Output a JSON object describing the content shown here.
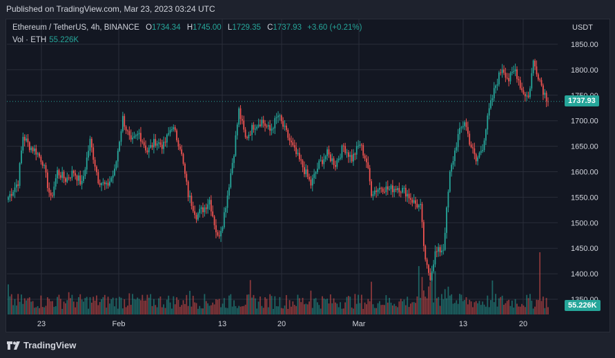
{
  "header": {
    "published": "Published on TradingView.com, Mar 23, 2023 03:24 UTC"
  },
  "legend": {
    "symbol": "Ethereum / TetherUS, 4h, BINANCE",
    "o_label": "O",
    "o_value": "1734.34",
    "h_label": "H",
    "h_value": "1745.00",
    "l_label": "L",
    "l_value": "1729.35",
    "c_label": "C",
    "c_value": "1737.93",
    "change": "+3.60 (+0.21%)",
    "vol_label": "Vol · ETH",
    "vol_value": "55.226K"
  },
  "axis": {
    "currency": "USDT"
  },
  "tags": {
    "price": "1737.93",
    "volume": "55.226K"
  },
  "footer": {
    "brand": "TradingView"
  },
  "colors": {
    "up": "#26a69a",
    "down": "#ef5350",
    "grid": "#2a2e39",
    "text": "#d1d4dc"
  },
  "chart_data": {
    "type": "candlestick",
    "y_ticks": [
      "1850.00",
      "1800.00",
      "1750.00",
      "1700.00",
      "1650.00",
      "1600.00",
      "1550.00",
      "1500.00",
      "1450.00",
      "1400.00",
      "1350.00"
    ],
    "ylim": [
      1350,
      1850
    ],
    "x_ticks": [
      "23",
      "Feb",
      "13",
      "20",
      "Mar",
      "13",
      "20"
    ],
    "last_price": 1737.93,
    "anchors": [
      [
        0,
        1550
      ],
      [
        6,
        1580
      ],
      [
        9,
        1670
      ],
      [
        13,
        1650
      ],
      [
        17,
        1640
      ],
      [
        21,
        1620
      ],
      [
        26,
        1545
      ],
      [
        30,
        1600
      ],
      [
        35,
        1585
      ],
      [
        40,
        1600
      ],
      [
        45,
        1575
      ],
      [
        50,
        1660
      ],
      [
        55,
        1585
      ],
      [
        60,
        1570
      ],
      [
        65,
        1600
      ],
      [
        70,
        1705
      ],
      [
        75,
        1655
      ],
      [
        80,
        1675
      ],
      [
        85,
        1640
      ],
      [
        90,
        1660
      ],
      [
        95,
        1650
      ],
      [
        100,
        1690
      ],
      [
        105,
        1650
      ],
      [
        110,
        1555
      ],
      [
        115,
        1515
      ],
      [
        120,
        1530
      ],
      [
        123,
        1545
      ],
      [
        128,
        1470
      ],
      [
        131,
        1500
      ],
      [
        134,
        1555
      ],
      [
        138,
        1640
      ],
      [
        141,
        1720
      ],
      [
        145,
        1665
      ],
      [
        150,
        1690
      ],
      [
        155,
        1700
      ],
      [
        160,
        1680
      ],
      [
        165,
        1710
      ],
      [
        170,
        1675
      ],
      [
        175,
        1640
      ],
      [
        180,
        1610
      ],
      [
        185,
        1575
      ],
      [
        190,
        1615
      ],
      [
        195,
        1635
      ],
      [
        200,
        1615
      ],
      [
        205,
        1650
      ],
      [
        210,
        1625
      ],
      [
        215,
        1655
      ],
      [
        219,
        1620
      ],
      [
        222,
        1560
      ],
      [
        228,
        1570
      ],
      [
        233,
        1565
      ],
      [
        238,
        1570
      ],
      [
        243,
        1560
      ],
      [
        248,
        1540
      ],
      [
        252,
        1530
      ],
      [
        255,
        1420
      ],
      [
        258,
        1395
      ],
      [
        261,
        1440
      ],
      [
        266,
        1450
      ],
      [
        270,
        1595
      ],
      [
        275,
        1670
      ],
      [
        279,
        1700
      ],
      [
        282,
        1660
      ],
      [
        286,
        1620
      ],
      [
        290,
        1650
      ],
      [
        294,
        1720
      ],
      [
        298,
        1770
      ],
      [
        302,
        1805
      ],
      [
        306,
        1780
      ],
      [
        310,
        1800
      ],
      [
        314,
        1760
      ],
      [
        318,
        1745
      ],
      [
        321,
        1815
      ],
      [
        324,
        1790
      ],
      [
        327,
        1760
      ],
      [
        330,
        1738
      ]
    ]
  }
}
